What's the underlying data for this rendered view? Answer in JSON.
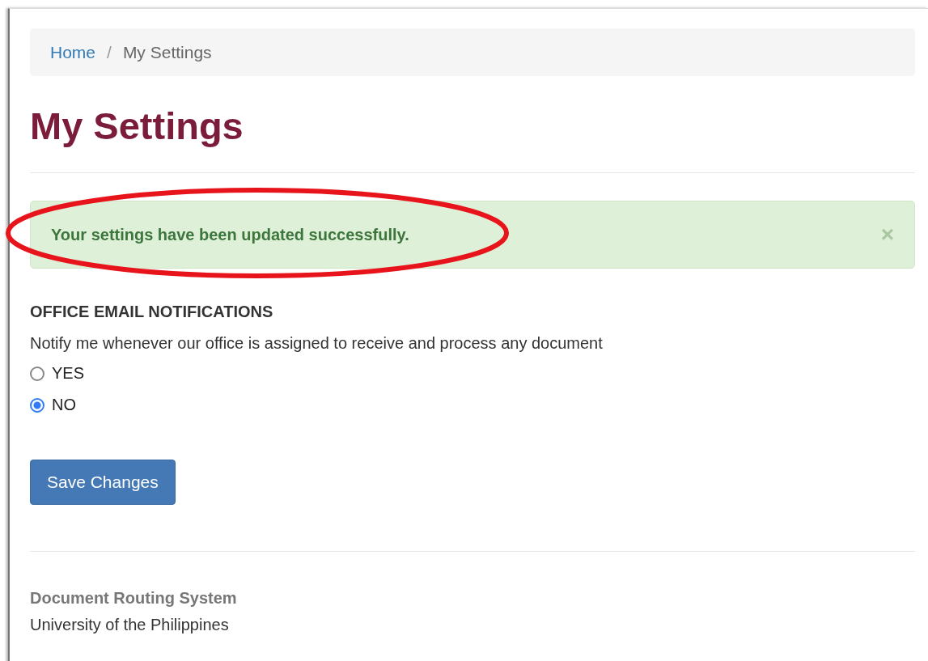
{
  "breadcrumb": [
    {
      "label": "Home",
      "kind": "link"
    },
    {
      "label": "My Settings",
      "kind": "current",
      "separator": "/"
    }
  ],
  "title": "My Settings",
  "alert": {
    "message": "Your settings have been updated successfully.",
    "close": "×",
    "highlighted": true
  },
  "section": {
    "heading": "OFFICE EMAIL NOTIFICATIONS",
    "description": "Notify me whenever our office is assigned to receive and process any document",
    "options": [
      {
        "label": "YES",
        "selected": false
      },
      {
        "label": "NO",
        "selected": true
      }
    ]
  },
  "save_button": "Save Changes",
  "footer": {
    "title": "Document Routing System",
    "subtitle": "University of the Philippines"
  }
}
